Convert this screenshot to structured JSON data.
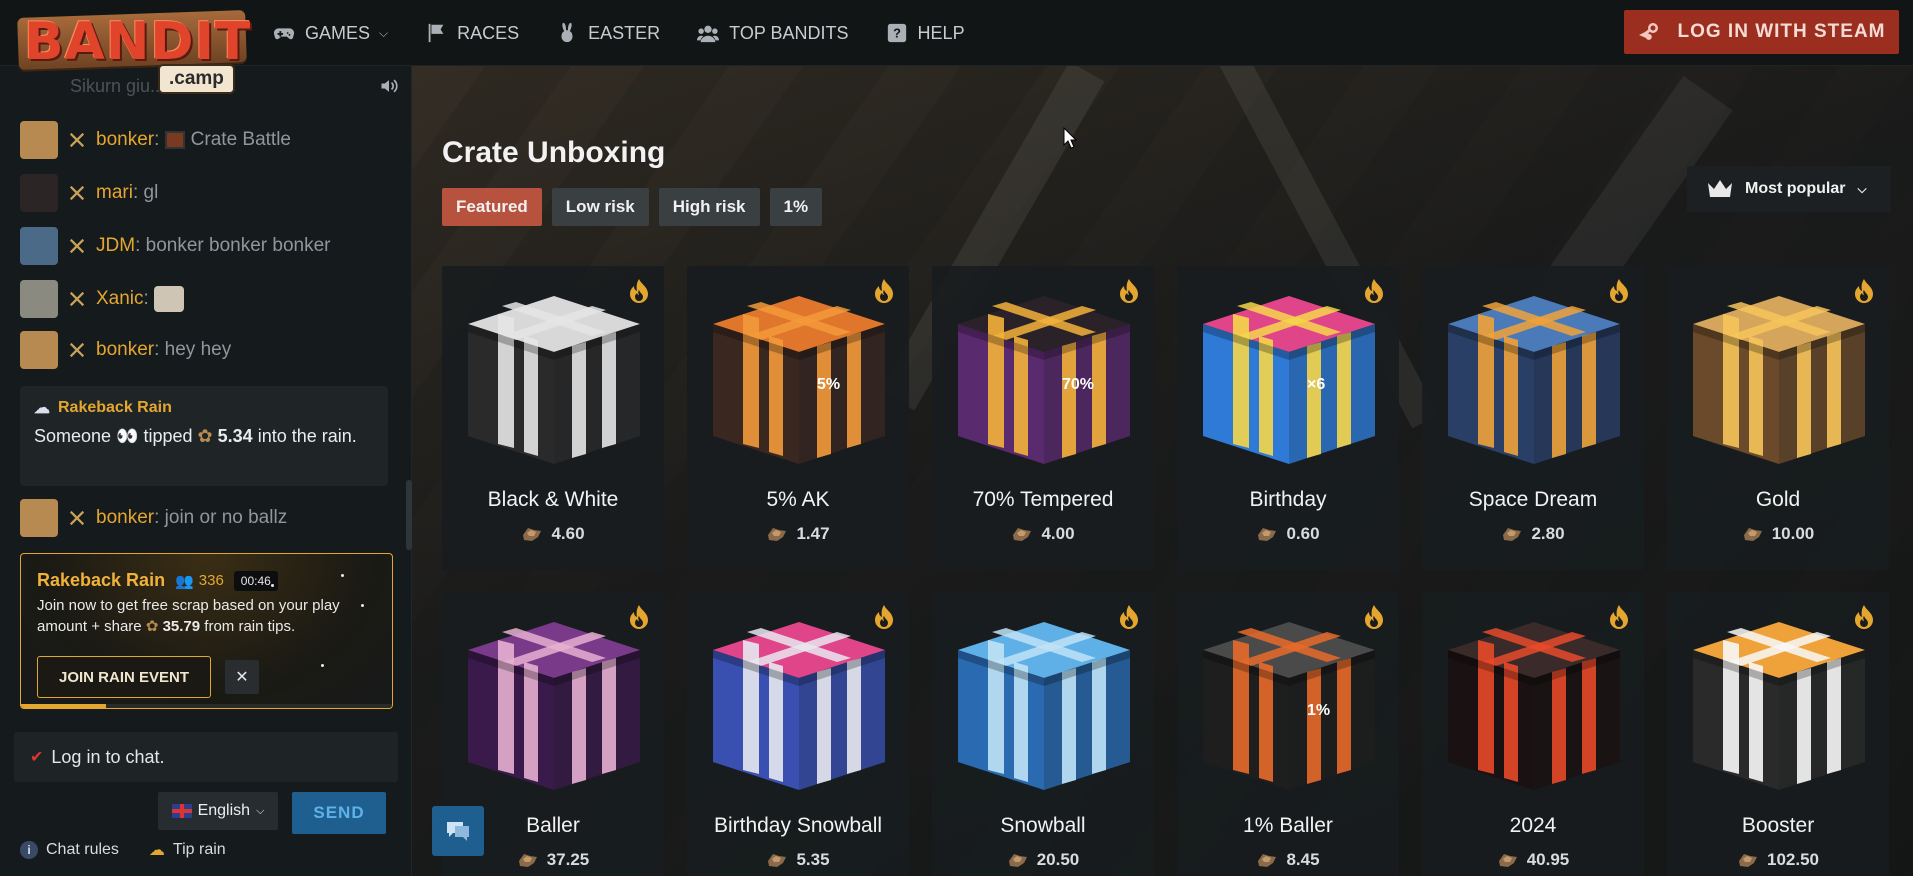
{
  "logo": {
    "word": "BANDIT",
    "sub": ".camp"
  },
  "nav": [
    {
      "label": "GAMES",
      "icon": "gamepad-icon",
      "dropdown": true
    },
    {
      "label": "RACES",
      "icon": "flag-icon"
    },
    {
      "label": "EASTER",
      "icon": "bunny-icon"
    },
    {
      "label": "TOP BANDITS",
      "icon": "users-icon"
    },
    {
      "label": "HELP",
      "icon": "help-icon"
    }
  ],
  "login": {
    "label": "LOG IN WITH STEAM",
    "icon": "steam-icon"
  },
  "chat": {
    "faded_text": "Sikurn giu...",
    "messages": [
      {
        "user": "bonker",
        "text": "Crate Battle",
        "avatar_color": "#b78a52"
      },
      {
        "user": "mari",
        "text": "gl",
        "avatar_color": "#2b2525"
      },
      {
        "user": "JDM",
        "text": "bonker bonker bonker",
        "avatar_color": "#4b6a88"
      },
      {
        "user": "Xanic",
        "text": "",
        "avatar_color": "#8a8a80"
      },
      {
        "user": "bonker",
        "text": "hey hey",
        "avatar_color": "#b78a52"
      }
    ],
    "rain_tip": {
      "title": "Rakeback Rain",
      "text_before": "Someone 👀 tipped",
      "amount": "5.34",
      "text_after": "into the rain."
    },
    "last_message": {
      "user": "bonker",
      "text": "join or no ballz",
      "avatar_color": "#b78a52"
    },
    "rain_event": {
      "title": "Rakeback Rain",
      "participants": "336",
      "timer": "00:46",
      "body_before": "Join now to get free scrap based on your play amount + share",
      "amount": "35.79",
      "body_after": "from rain tips.",
      "join_label": "JOIN RAIN EVENT",
      "close_label": "✕",
      "progress": 0.23
    },
    "input_placeholder": "Log in to chat.",
    "language": "English",
    "send_label": "SEND",
    "footer": {
      "rules": "Chat rules",
      "tip": "Tip rain"
    }
  },
  "main": {
    "title": "Crate Unboxing",
    "filters": [
      "Featured",
      "Low risk",
      "High risk",
      "1%"
    ],
    "active_filter": 0,
    "sort_label": "Most popular",
    "crates": [
      {
        "name": "Black & White",
        "price": "4.60",
        "top": "#d8d8d8",
        "side": "#2a2a2a",
        "band": "#e5e5e5",
        "label": ""
      },
      {
        "name": "5% AK",
        "price": "1.47",
        "top": "#e0762c",
        "side": "#3a2720",
        "band": "#f39a3a",
        "label": "5%"
      },
      {
        "name": "70% Tempered",
        "price": "4.00",
        "top": "#2a2228",
        "side": "#5a2a6e",
        "band": "#f3b13a",
        "label": "70%"
      },
      {
        "name": "Birthday",
        "price": "0.60",
        "top": "#e0458a",
        "side": "#2f7ad6",
        "band": "#f5d64a",
        "label": "×6"
      },
      {
        "name": "Space Dream",
        "price": "2.80",
        "top": "#4b7ab8",
        "side": "#2a3f66",
        "band": "#f0a23a",
        "label": ""
      },
      {
        "name": "Gold",
        "price": "10.00",
        "top": "#d4a55a",
        "side": "#6a4a2a",
        "band": "#f6c45a",
        "label": ""
      },
      {
        "name": "Baller",
        "price": "37.25",
        "top": "#7a3a8a",
        "side": "#3a1a4a",
        "band": "#e6b0d0",
        "label": ""
      },
      {
        "name": "Birthday Snowball",
        "price": "5.35",
        "top": "#e0458a",
        "side": "#3a50b0",
        "band": "#e8e8f0",
        "label": ""
      },
      {
        "name": "Snowball",
        "price": "20.50",
        "top": "#5fb0e6",
        "side": "#2a6ab0",
        "band": "#bfe3f6",
        "label": ""
      },
      {
        "name": "1% Baller",
        "price": "8.45",
        "top": "#4a4a4a",
        "side": "#1e1e1e",
        "band": "#e86a2a",
        "label": "1%"
      },
      {
        "name": "2024",
        "price": "40.95",
        "top": "#3a2a2a",
        "side": "#1a1212",
        "band": "#e84a2a",
        "label": ""
      },
      {
        "name": "Booster",
        "price": "102.50",
        "top": "#f0a23a",
        "side": "#2a2a2a",
        "band": "#f8f8f8",
        "label": ""
      }
    ]
  },
  "colors": {
    "accent": "#e5a630",
    "brand_red": "#9b2e1f",
    "active_filter": "#b6523e",
    "send_blue": "#1f5f90"
  }
}
